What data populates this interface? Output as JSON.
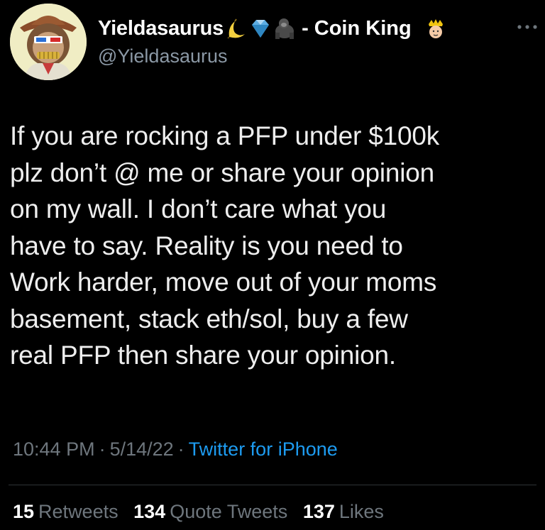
{
  "author": {
    "display_name": "Yieldasaurus",
    "name_suffix": "- Coin King",
    "handle": "@Yieldasaurus",
    "avatar_icon": "ape-avatar-icon",
    "name_emojis": [
      "banana-icon",
      "diamond-icon",
      "gorilla-icon"
    ],
    "suffix_emoji": "crown-icon"
  },
  "tweet": {
    "text": "If you are rocking a PFP under $100k\nplz don’t @ me or share your opinion\non my wall.  I don’t care what you\nhave to say. Reality is you need to\nWork harder, move out of your moms\nbasement, stack eth/sol, buy a few\nreal PFP then share your opinion."
  },
  "meta": {
    "time": "10:44 PM",
    "separator": "·",
    "date": "5/14/22",
    "source": "Twitter for iPhone"
  },
  "stats": {
    "retweets_count": "15",
    "retweets_label": "Retweets",
    "quotes_count": "134",
    "quotes_label": "Quote Tweets",
    "likes_count": "137",
    "likes_label": "Likes"
  },
  "colors": {
    "background": "#000000",
    "text": "#e7e9ea",
    "secondary": "#6e767d",
    "link": "#1d9bf0"
  }
}
